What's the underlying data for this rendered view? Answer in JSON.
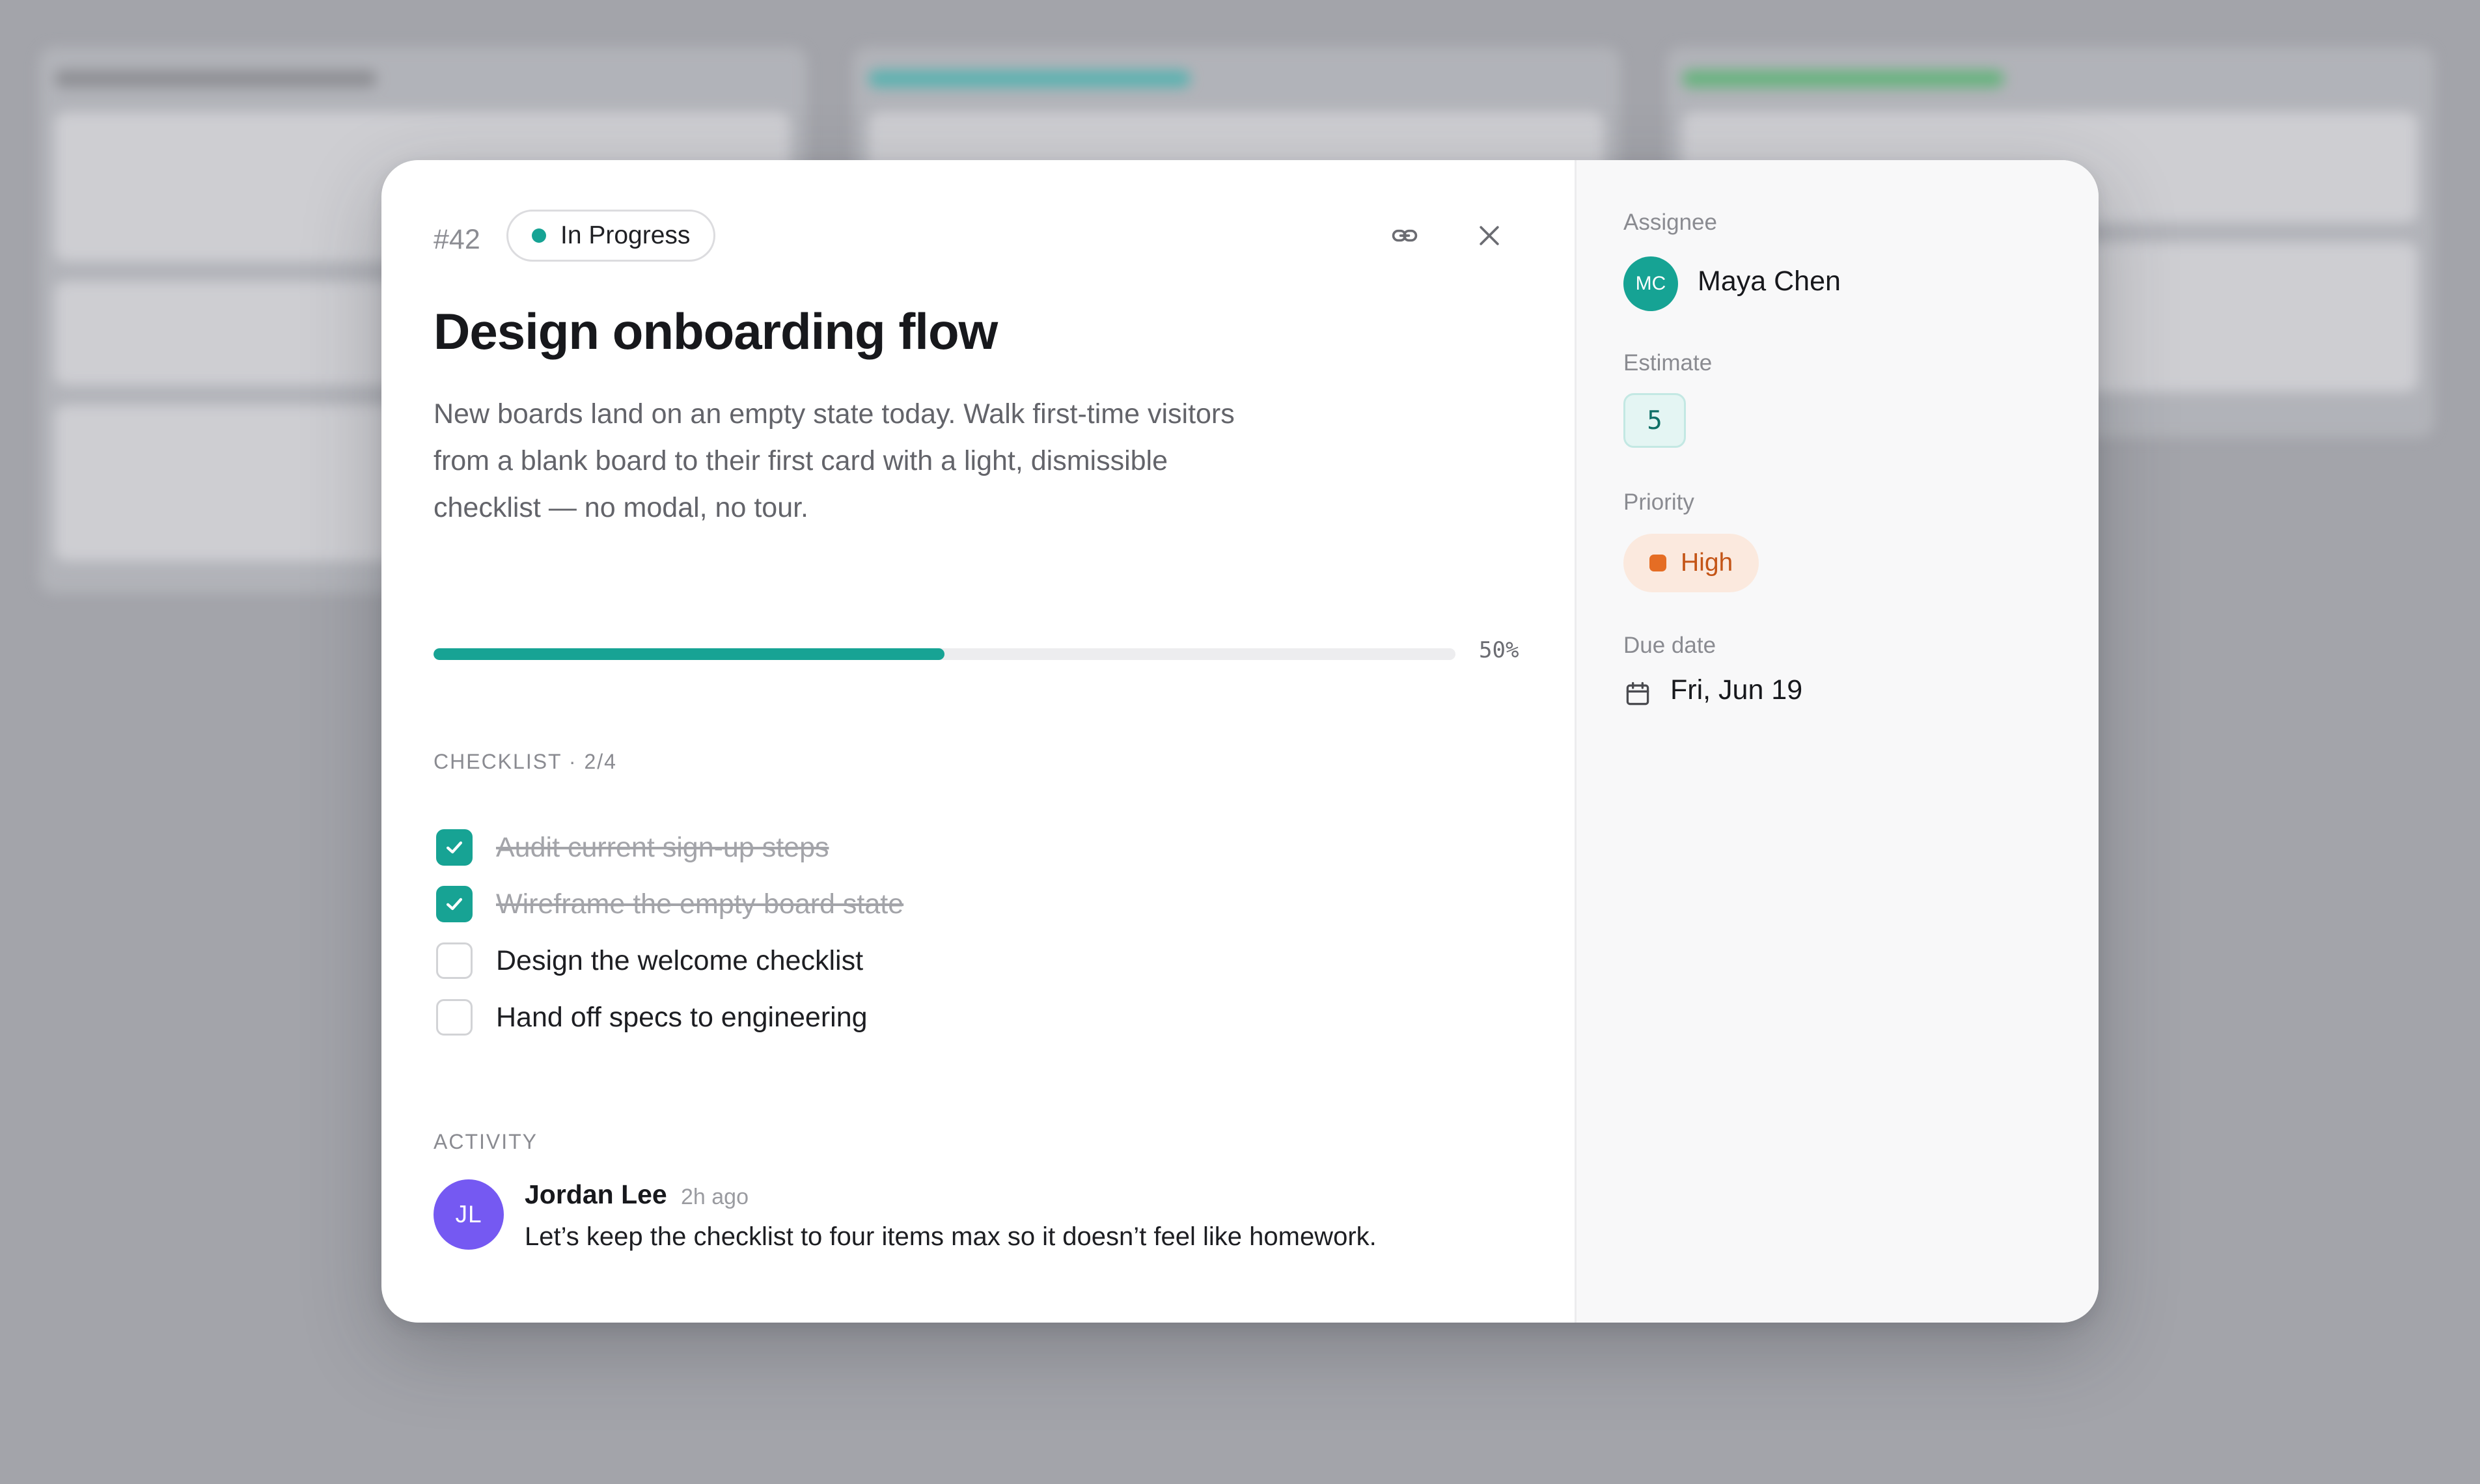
{
  "colors": {
    "accent": "#17a394",
    "priority_high": "#e56d24",
    "comment_avatar": "#7559f2",
    "board_column_1": "#8e8f94",
    "board_column_2": "#5ab2b0",
    "board_column_3": "#66b37d"
  },
  "card": {
    "id": "#42",
    "status": "In Progress",
    "title": "Design onboarding flow",
    "description": "New boards land on an empty state today. Walk first-time visitors from a blank board to their first card with a light, dismissible checklist — no modal, no tour."
  },
  "checklist": {
    "header": "CHECKLIST · 2/4",
    "progress_percent": 50,
    "progress_label": "50%",
    "items": [
      {
        "label": "Audit current sign-up steps",
        "done": true
      },
      {
        "label": "Wireframe the empty board state",
        "done": true
      },
      {
        "label": "Design the welcome checklist",
        "done": false
      },
      {
        "label": "Hand off specs to engineering",
        "done": false
      }
    ]
  },
  "activity": {
    "header": "ACTIVITY",
    "comments": [
      {
        "initials": "JL",
        "author": "Jordan Lee",
        "time": "2h ago",
        "text": "Let’s keep the checklist to four items max so it doesn’t feel like homework."
      }
    ]
  },
  "sidebar": {
    "assignee_label": "Assignee",
    "assignee_initials": "MC",
    "assignee_name": "Maya Chen",
    "estimate_label": "Estimate",
    "estimate_value": "5",
    "priority_label": "Priority",
    "priority_value": "High",
    "due_label": "Due date",
    "due_value": "Fri, Jun 19"
  },
  "icons": {
    "link": "link-icon",
    "close": "close-icon",
    "check": "check-icon",
    "calendar": "calendar-icon"
  }
}
